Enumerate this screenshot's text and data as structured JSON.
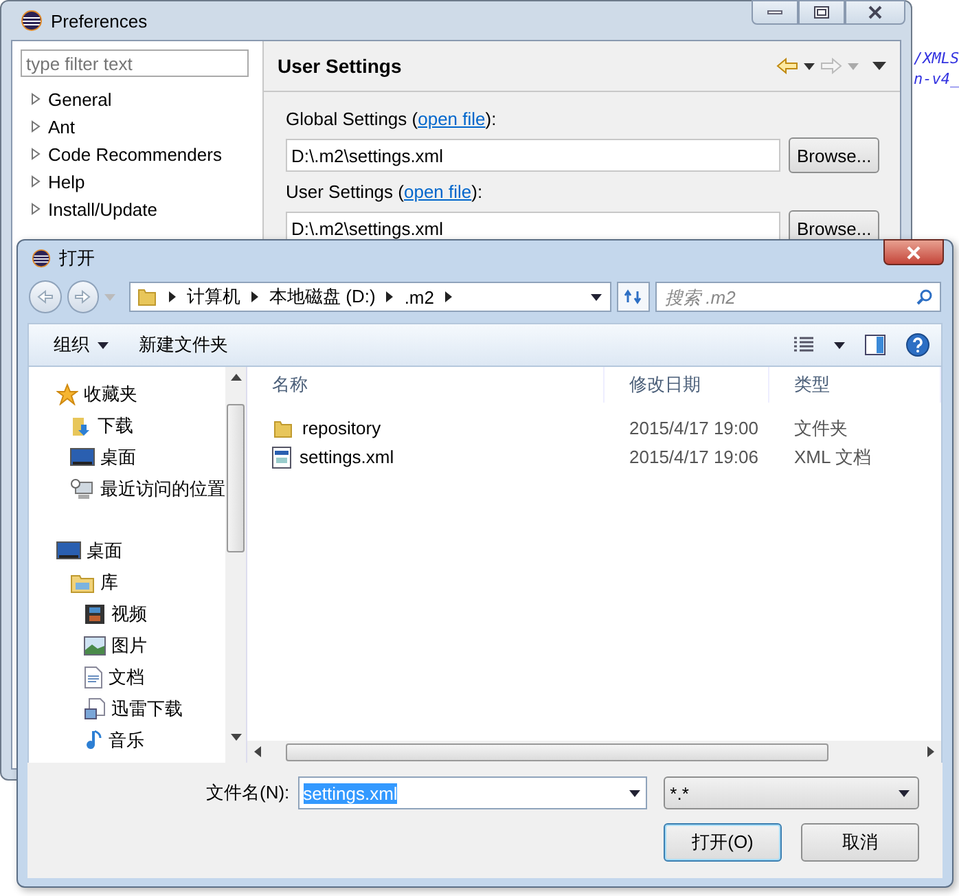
{
  "editor_background": {
    "lines": [
      "/XMLS",
      "n-v4_"
    ]
  },
  "preferences": {
    "title": "Preferences",
    "filter": {
      "placeholder": "type filter text"
    },
    "tree": [
      {
        "label": "General",
        "expanded": false
      },
      {
        "label": "Ant",
        "expanded": false
      },
      {
        "label": "Code Recommenders",
        "expanded": false
      },
      {
        "label": "Help",
        "expanded": false
      },
      {
        "label": "Install/Update",
        "expanded": false
      }
    ],
    "page": {
      "title": "User Settings",
      "settings": [
        {
          "label": "Global Settings (",
          "link": "open file",
          "suffix": "):",
          "value": "D:\\.m2\\settings.xml",
          "button": "Browse..."
        },
        {
          "label": "User Settings (",
          "link": "open file",
          "suffix": "):",
          "value": "D:\\.m2\\settings.xml",
          "button": "Browse..."
        }
      ]
    }
  },
  "open_dialog": {
    "title": "打开",
    "breadcrumb": [
      "计算机",
      "本地磁盘 (D:)",
      ".m2"
    ],
    "search": {
      "placeholder": "搜索 .m2"
    },
    "toolbar": {
      "organize": "组织",
      "new_folder": "新建文件夹"
    },
    "nav": [
      {
        "label": "收藏夹",
        "kind": "star",
        "children": [
          {
            "label": "下载",
            "kind": "download"
          },
          {
            "label": "桌面",
            "kind": "desktop"
          },
          {
            "label": "最近访问的位置",
            "kind": "recent"
          }
        ]
      },
      {
        "label": "桌面",
        "kind": "desktop",
        "children": [
          {
            "label": "库",
            "kind": "library",
            "children": [
              {
                "label": "视频",
                "kind": "video"
              },
              {
                "label": "图片",
                "kind": "picture"
              },
              {
                "label": "文档",
                "kind": "document"
              },
              {
                "label": "迅雷下载",
                "kind": "document2"
              },
              {
                "label": "音乐",
                "kind": "music"
              }
            ]
          }
        ]
      }
    ],
    "columns": [
      "名称",
      "修改日期",
      "类型"
    ],
    "files": [
      {
        "name": "repository",
        "modified": "2015/4/17 19:00",
        "type": "文件夹",
        "kind": "folder",
        "selected": false
      },
      {
        "name": "settings.xml",
        "modified": "2015/4/17 19:06",
        "type": "XML 文档",
        "kind": "xml",
        "selected": false
      }
    ],
    "filename": {
      "label": "文件名(N):",
      "value": "settings.xml"
    },
    "filter": "*.*",
    "buttons": [
      {
        "label": "打开(O)",
        "default": true
      },
      {
        "label": "取消",
        "default": false
      }
    ]
  }
}
